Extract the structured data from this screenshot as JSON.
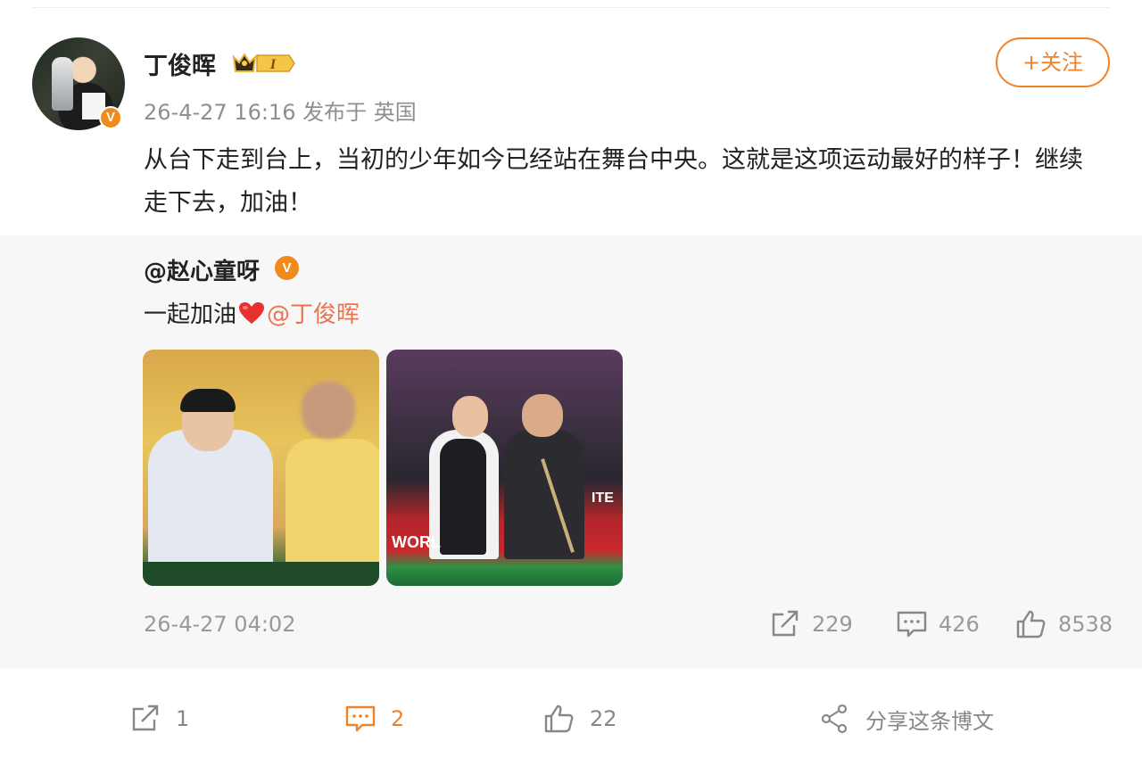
{
  "post": {
    "author": "丁俊晖",
    "verified_badge": "V",
    "member_badge_text": "I",
    "time_source": "26-4-27 16:16 发布于 英国",
    "follow_label": "+关注",
    "text": "从台下走到台上，当初的少年如今已经站在舞台中央。这就是这项运动最好的样子！继续走下去，加油！"
  },
  "repost": {
    "author": "@赵心童呀",
    "verified_badge": "V",
    "text_before": "一起加油",
    "mention": "@丁俊晖",
    "photo2_banner": "WORL",
    "photo2_sign": "ITE",
    "date": "26-4-27 04:02",
    "shares": "229",
    "comments": "426",
    "likes": "8538"
  },
  "actions": {
    "share_count": "1",
    "comment_count": "2",
    "like_count": "22",
    "share_this_label": "分享这条博文"
  },
  "colors": {
    "accent": "#f0822a",
    "mention": "#eb7350",
    "repost_bg": "#f7f7f7",
    "meta_gray": "#8f8f8f"
  }
}
